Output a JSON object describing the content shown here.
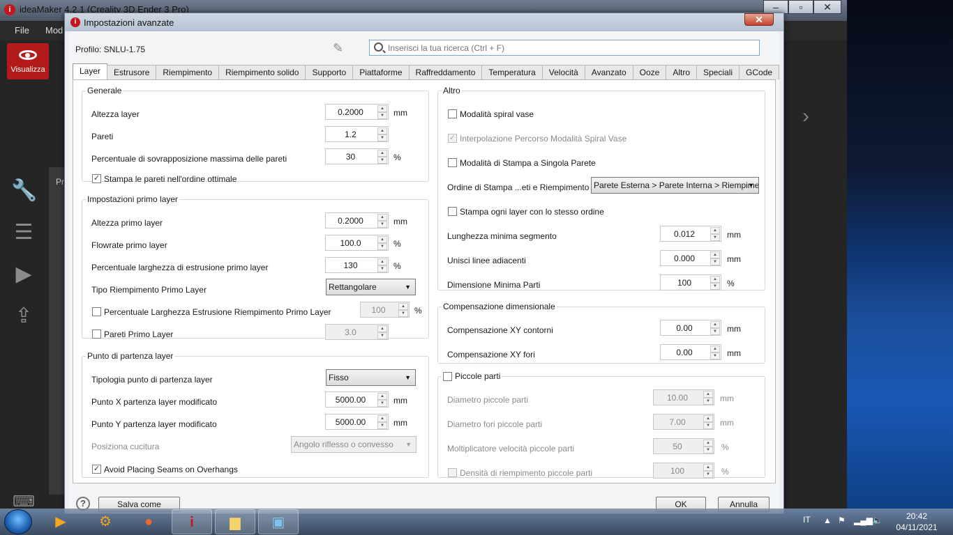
{
  "app": {
    "title": "ideaMaker 4.2.1 (Creality 3D Ender 3 Pro)",
    "menu": [
      "File",
      "Mod"
    ],
    "visualizza": "Visualizza",
    "side_label": "Pr"
  },
  "dialog": {
    "title": "Impostazioni avanzate",
    "profile": "Profilo: SNLU-1.75",
    "search_placeholder": "Inserisci la tua ricerca (Ctrl + F)",
    "tabs": [
      "Layer",
      "Estrusore",
      "Riempimento",
      "Riempimento solido",
      "Supporto",
      "Piattaforme",
      "Raffreddamento",
      "Temperatura",
      "Velocità",
      "Avanzato",
      "Ooze",
      "Altro",
      "Speciali",
      "GCode"
    ],
    "buttons": {
      "save_as": "Salva come",
      "ok": "OK",
      "cancel": "Annulla"
    }
  },
  "generale": {
    "title": "Generale",
    "altezza_layer": {
      "label": "Altezza layer",
      "value": "0.2000",
      "unit": "mm"
    },
    "pareti": {
      "label": "Pareti",
      "value": "1.2"
    },
    "sovrapposizione": {
      "label": "Percentuale di sovrapposizione massima delle pareti",
      "value": "30",
      "unit": "%"
    },
    "ordine_ottimale": {
      "label": "Stampa le pareti nell'ordine ottimale",
      "checked": "✓"
    }
  },
  "primo_layer": {
    "title": "Impostazioni primo layer",
    "altezza": {
      "label": "Altezza primo layer",
      "value": "0.2000",
      "unit": "mm"
    },
    "flowrate": {
      "label": "Flowrate primo layer",
      "value": "100.0",
      "unit": "%"
    },
    "larghezza": {
      "label": "Percentuale larghezza di estrusione primo layer",
      "value": "130",
      "unit": "%"
    },
    "tipo": {
      "label": "Tipo Riempimento Primo Layer",
      "value": "Rettangolare"
    },
    "perc_riemp": {
      "label": "Percentuale Larghezza Estrusione Riempimento Primo Layer",
      "value": "100",
      "unit": "%"
    },
    "pareti": {
      "label": "Pareti Primo Layer",
      "value": "3.0"
    }
  },
  "partenza": {
    "title": "Punto di partenza layer",
    "tipologia": {
      "label": "Tipologia punto di partenza layer",
      "value": "Fisso"
    },
    "x": {
      "label": "Punto X partenza layer modificato",
      "value": "5000.00",
      "unit": "mm"
    },
    "y": {
      "label": "Punto Y partenza layer modificato",
      "value": "5000.00",
      "unit": "mm"
    },
    "cucitura": {
      "label": "Posiziona cucitura",
      "value": "Angolo riflesso o convesso"
    },
    "seams": {
      "label": "Avoid Placing Seams on Overhangs",
      "checked": "✓"
    }
  },
  "altro": {
    "title": "Altro",
    "spiral": {
      "label": "Modalità spiral vase"
    },
    "interp": {
      "label": "Interpolazione Percorso Modalità Spiral Vase",
      "checked": "✓"
    },
    "singola": {
      "label": "Modalità di Stampa a Singola Parete"
    },
    "ordine": {
      "label": "Ordine di Stampa ...eti e Riempimento",
      "value": "Parete Esterna > Parete Interna > Riempimen"
    },
    "stesso": {
      "label": "Stampa ogni layer con lo stesso ordine"
    },
    "segmento": {
      "label": "Lunghezza minima segmento",
      "value": "0.012",
      "unit": "mm"
    },
    "unisci": {
      "label": "Unisci linee adiacenti",
      "value": "0.000",
      "unit": "mm"
    },
    "dimensione": {
      "label": "Dimensione Minima Parti",
      "value": "100",
      "unit": "%"
    }
  },
  "compensazione": {
    "title": "Compensazione dimensionale",
    "contorni": {
      "label": "Compensazione XY contorni",
      "value": "0.00",
      "unit": "mm"
    },
    "fori": {
      "label": "Compensazione XY fori",
      "value": "0.00",
      "unit": "mm"
    }
  },
  "piccole": {
    "title": "Piccole parti",
    "diametro": {
      "label": "Diametro piccole parti",
      "value": "10.00",
      "unit": "mm"
    },
    "diam_fori": {
      "label": "Diametro fori piccole parti",
      "value": "7.00",
      "unit": "mm"
    },
    "moltiplicatore": {
      "label": "Moltiplicatore velocità piccole parti",
      "value": "50",
      "unit": "%"
    },
    "densita": {
      "label": "Densità di riempimento piccole parti",
      "value": "100",
      "unit": "%"
    }
  },
  "taskbar": {
    "lang": "IT",
    "time": "20:42",
    "date": "04/11/2021"
  }
}
